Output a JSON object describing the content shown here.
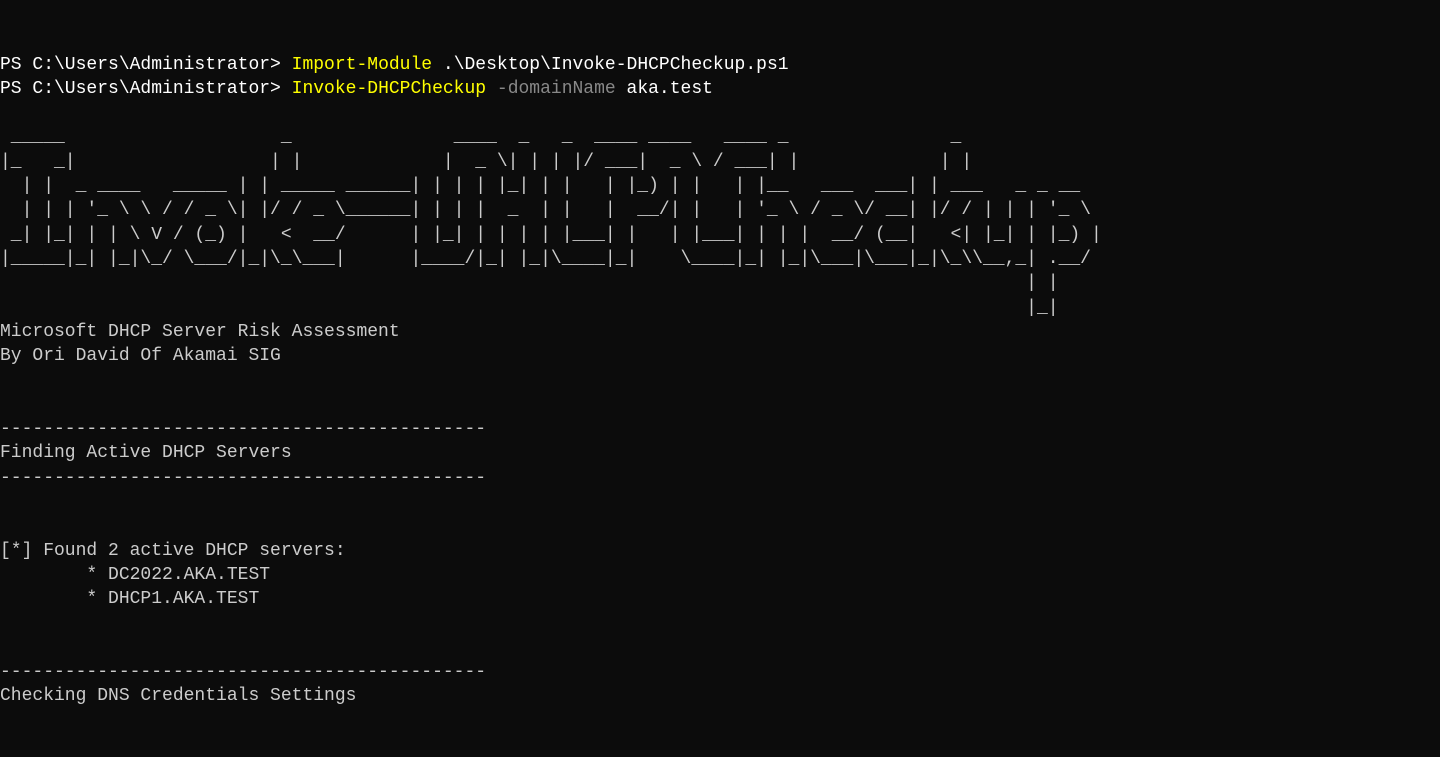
{
  "line1": {
    "prompt": "PS C:\\Users\\Administrator> ",
    "cmd": "Import-Module ",
    "arg": ".\\Desktop\\Invoke-DHCPCheckup.ps1"
  },
  "line2": {
    "prompt": "PS C:\\Users\\Administrator> ",
    "cmd": "Invoke-DHCPCheckup ",
    "param": "-domainName ",
    "arg": "aka.test"
  },
  "ascii_art": " _____                    _               ____  _   _  ____ ____   ____ _               _\n|_   _|                  | |             |  _ \\| | | |/ ___|  _ \\ / ___| |             | |\n  | |  _ ____   _____ | | _____ ______| | | | |_| | |   | |_) | |   | |__   ___  ___| | ___   _ _ __\n  | | | '_ \\ \\ / / _ \\| |/ / _ \\______| | | |  _  | |   |  __/| |   | '_ \\ / _ \\/ __| |/ / | | | '_ \\\n _| |_| | | \\ V / (_) |   <  __/      | |_| | | | | |___| |   | |___| | | |  __/ (__|   <| |_| | |_) |\n|_____|_| |_|\\_/ \\___/|_|\\_\\___|      |____/|_| |_|\\____|_|    \\____|_| |_|\\___|\\___|_|\\_\\\\__,_| .__/\n                                                                                               | |\n                                                                                               |_|",
  "title_line": "Microsoft DHCP Server Risk Assessment",
  "author_line": "By Ori David Of Akamai SIG",
  "separator": "---------------------------------------------",
  "section1_title": "Finding Active DHCP Servers",
  "found_line": "[*] Found 2 active DHCP servers:",
  "server1": "        * DC2022.AKA.TEST",
  "server2": "        * DHCP1.AKA.TEST",
  "section2_title": "Checking DNS Credentials Settings"
}
